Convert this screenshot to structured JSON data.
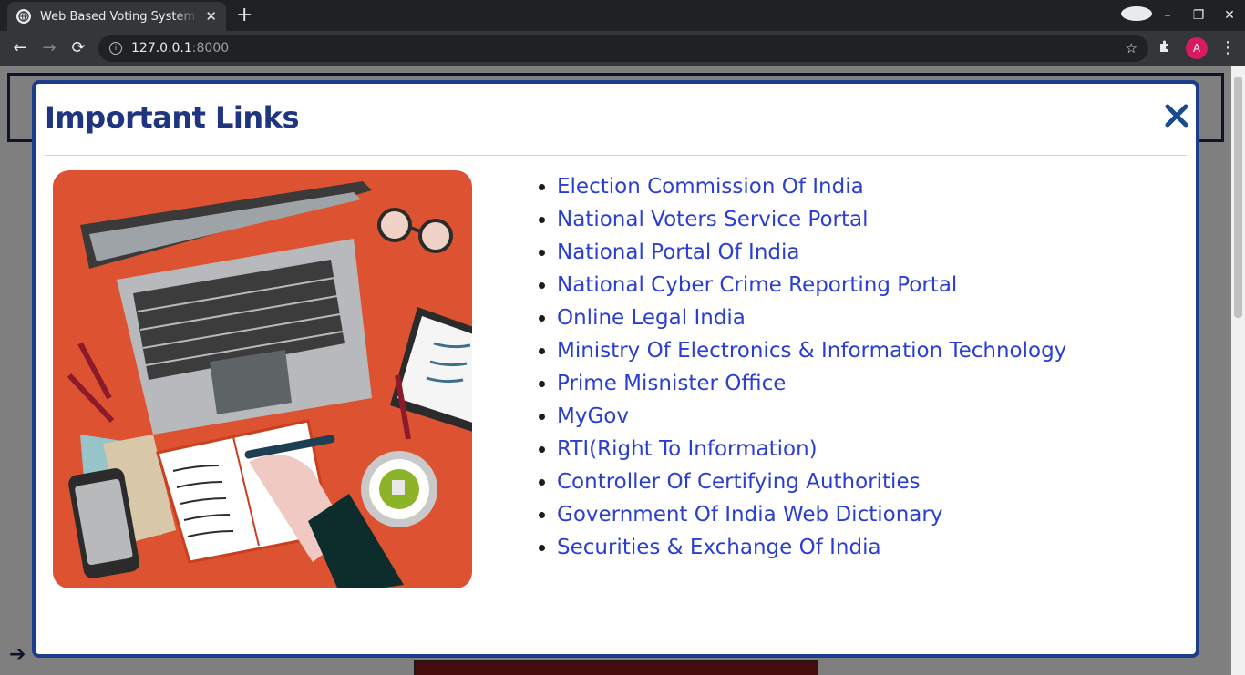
{
  "browser": {
    "tab_title": "Web Based Voting System",
    "new_tab_label": "+",
    "tab_close_label": "✕",
    "url_host": "127.0.0.1",
    "url_port": ":8000",
    "avatar_letter": "A",
    "nav": {
      "back": "←",
      "forward": "→",
      "reload": "⟳"
    },
    "bookmark_icon": "☆",
    "extensions_icon": "puzzle-icon",
    "menu_icon": "⋮"
  },
  "modal": {
    "title": "Important Links",
    "close_icon": "close-icon",
    "accent_color": "#1d3c8c",
    "link_color": "#2a3fcf",
    "links": [
      "Election Commission Of India",
      "National Voters Service Portal",
      "National Portal Of India",
      "National Cyber Crime Reporting Portal",
      "Online Legal India",
      "Ministry Of Electronics & Information Technology",
      "Prime Misnister Office",
      "MyGov",
      "RTI(Right To Information)",
      "Controller Of Certifying Authorities",
      "Government Of India Web Dictionary",
      "Securities & Exchange Of India"
    ]
  }
}
